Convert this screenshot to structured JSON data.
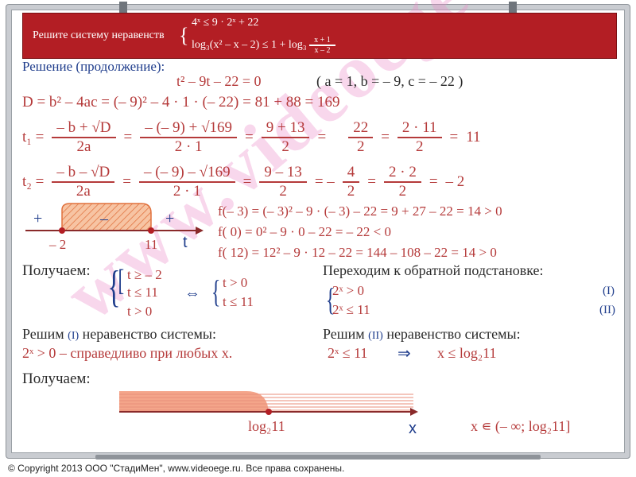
{
  "banner": {
    "label": "Решите систему неравенств",
    "eq1": "4ˣ ≤ 9 · 2ˣ + 22",
    "eq2_a": "log₃(x² – x – 2) ≤ 1 + log₃",
    "eq2_num": "x + 1",
    "eq2_den": "x – 2"
  },
  "solution_title": "Решение (продолжение):",
  "quadratic": "t² – 9t – 22 = 0",
  "coeffs": "( a = 1, b = – 9, c = – 22 )",
  "discriminant": "D = b² – 4ac = (– 9)² – 4 · 1 · (– 22) = 81 + 88 = 169",
  "t1": {
    "label": "t₁ =",
    "f1n": "– b + √D",
    "f1d": "2a",
    "f2n": "– (– 9) + √169",
    "f2d": "2 · 1",
    "f3n": "9 + 13",
    "f3d": "2",
    "f4n": "22",
    "f4d": "2",
    "f5n": "2 · 11",
    "f5d": "2",
    "result": "11"
  },
  "t2": {
    "label": "t₂ =",
    "f1n": "– b – √D",
    "f1d": "2a",
    "f2n": "– (– 9) – √169",
    "f2d": "2 · 1",
    "f3n": "9 – 13",
    "f3d": "2",
    "f4n": "4",
    "f4d": "2",
    "f5n": "2 · 2",
    "f5d": "2",
    "result": "– 2",
    "minus_sign": "= –"
  },
  "line1": {
    "plus_left": "+",
    "minus": "–",
    "plus_right": "+",
    "p1": "– 2",
    "p2": "11",
    "var": "t"
  },
  "fchecks": [
    "f(– 3) = (– 3)² – 9 · (– 3) – 22 = 9 + 27 – 22 = 14 > 0",
    "f( 0) = 0² – 9 · 0 – 22 = – 22 < 0",
    "f( 12) = 12² – 9 · 12 – 22 = 144 – 108 – 22 = 14 > 0"
  ],
  "get1": {
    "label": "Получаем:",
    "a": "t ≥ – 2",
    "b": "t ≤ 11",
    "c": "t > 0",
    "equiv": "⇔",
    "d": "t > 0",
    "e": "t ≤ 11"
  },
  "reverse": {
    "title": "Переходим к обратной подстановке:",
    "l1": "2ˣ > 0",
    "l2": "2ˣ ≤ 11",
    "r1": "(I)",
    "r2": "(II)"
  },
  "solve1": {
    "title_a": "Решим",
    "tag": "(I)",
    "title_b": "неравенство системы:",
    "body": "2ˣ > 0 – справедливо при любых x."
  },
  "solve2": {
    "title_a": "Решим",
    "tag": "(II)",
    "title_b": "неравенство системы:",
    "body_a": "2ˣ ≤ 11",
    "arrow": "⇒",
    "body_b": "x ≤ log₂11"
  },
  "get2": {
    "label": "Получаем:",
    "point": "log₂11",
    "var": "x",
    "answer": "x ∊ (– ∞; log₂11]"
  },
  "watermark": "www.videoege.ru",
  "copyright": "© Copyright 2013 ООО \"СтадиМен\", www.videoege.ru. Все права сохранены.",
  "colors": {
    "banner": "#b31e24",
    "text_red": "#b53a3a",
    "text_blue": "#1f3d8c",
    "shade": "#f4a58a"
  }
}
